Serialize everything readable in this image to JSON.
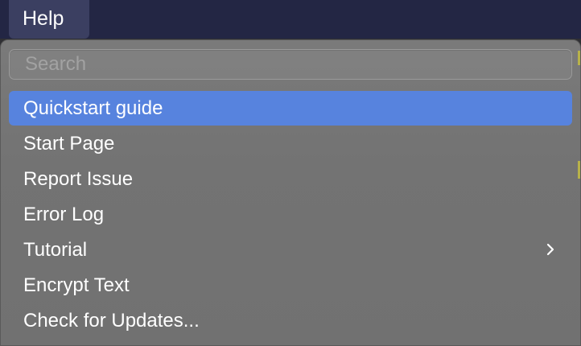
{
  "menubar": {
    "title": "Help"
  },
  "menu": {
    "search_placeholder": "Search",
    "items": [
      {
        "label": "Quickstart guide",
        "selected": true
      },
      {
        "label": "Start Page"
      },
      {
        "label": "Report Issue"
      },
      {
        "label": "Error Log"
      },
      {
        "label": "Tutorial",
        "submenu_icon": "chevron-right-icon"
      },
      {
        "label": "Encrypt Text"
      },
      {
        "label": "Check for Updates..."
      }
    ]
  },
  "colors": {
    "menubar_bg": "#232644",
    "selected_bg": "#5783de",
    "menu_bg": "#777777"
  }
}
